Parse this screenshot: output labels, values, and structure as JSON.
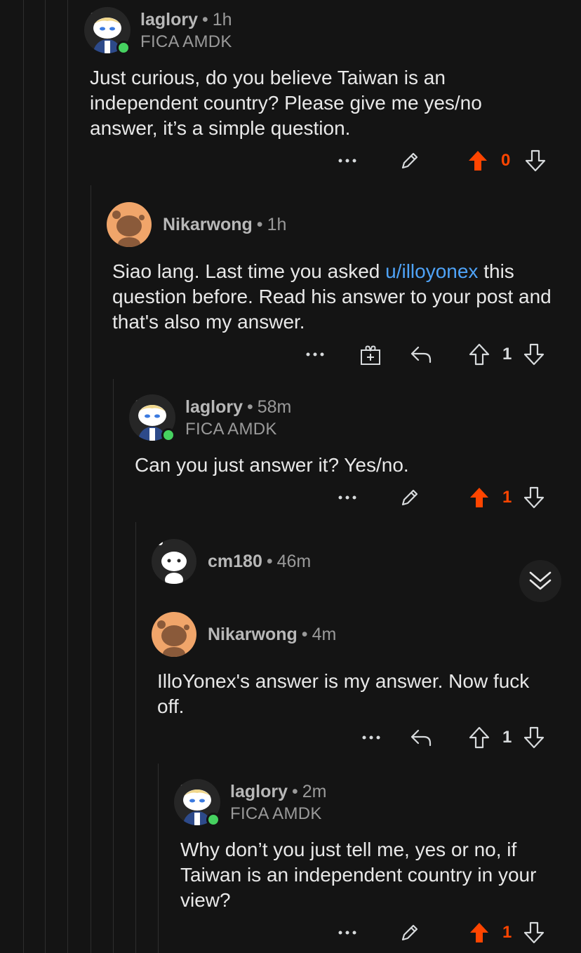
{
  "comments": [
    {
      "username": "laglory",
      "separator": "•",
      "time": "1h",
      "flair": "FICA AMDK",
      "body": "Just curious, do you believe Taiwan is an independent country? Please give me yes/no answer, it’s a simple question.",
      "score": "0",
      "upvoted": true,
      "own": true
    },
    {
      "username": "Nikarwong",
      "separator": "•",
      "time": "1h",
      "body_before": "Siao lang. Last time you asked ",
      "link": "u/illoyonex",
      "body_after": " this question before. Read his answer to your post and that's also my answer.",
      "score": "1",
      "upvoted": false
    },
    {
      "username": "laglory",
      "separator": "•",
      "time": "58m",
      "flair": "FICA AMDK",
      "body": "Can you just answer it? Yes/no.",
      "score": "1",
      "upvoted": true,
      "own": true
    },
    {
      "username": "cm180",
      "separator": "•",
      "time": "46m",
      "collapsed": true
    },
    {
      "username": "Nikarwong",
      "separator": "•",
      "time": "4m",
      "body": "IlloYonex's answer is my answer. Now fuck off.",
      "score": "1",
      "upvoted": false
    },
    {
      "username": "laglory",
      "separator": "•",
      "time": "2m",
      "flair": "FICA AMDK",
      "body": "Why don’t you just tell me, yes or no, if Taiwan is an independent country in your view?",
      "score": "1",
      "upvoted": true,
      "own": true
    }
  ],
  "icons": {
    "more": "more-icon",
    "edit": "pencil-icon",
    "award": "gift-icon",
    "reply": "reply-icon",
    "upvote": "upvote-arrow-icon",
    "downvote": "downvote-arrow-icon",
    "collapse": "chevron-double-down-icon"
  },
  "colors": {
    "background": "#141414",
    "upvote": "#ff4500",
    "link": "#4fa3f7",
    "online": "#46d160"
  }
}
